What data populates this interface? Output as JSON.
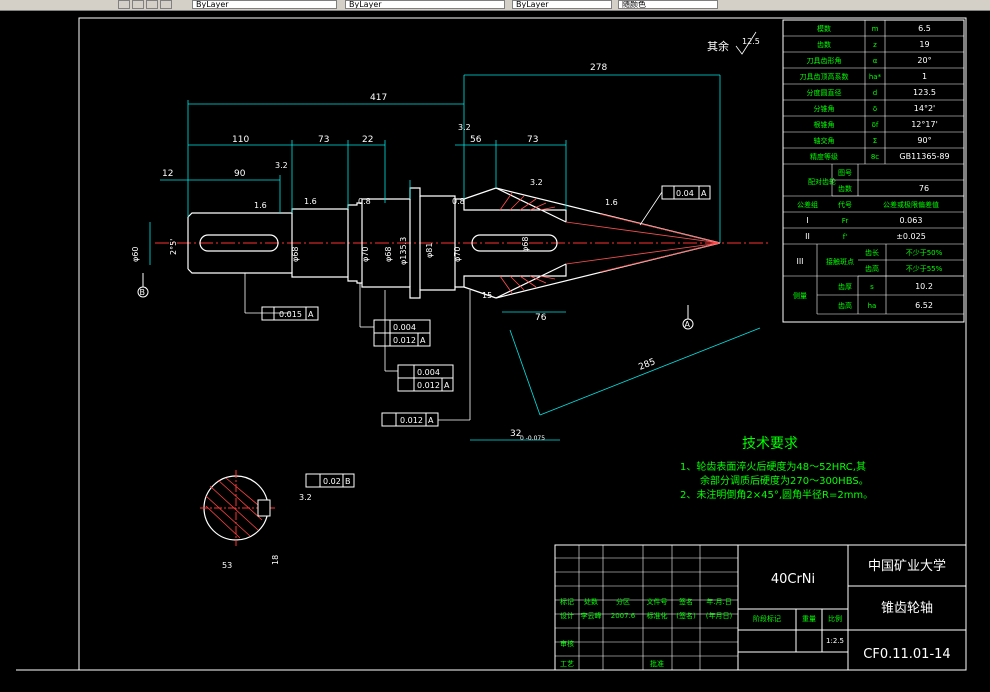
{
  "toolbar": {
    "layer_combo": "ByLayer",
    "linetype_combo": "ByLayer",
    "lineweight_combo": "ByLayer",
    "color_combo": "随颜色"
  },
  "drawing": {
    "surface_roughness_note": "其余",
    "surface_roughness_value": "12.5",
    "dimensions": {
      "overall_length": "417",
      "gear_length": "278",
      "d110": "110",
      "d73a": "73",
      "d22": "22",
      "d56": "56",
      "d73b": "73",
      "d12": "12",
      "d90": "90",
      "d76": "76",
      "d285": "285",
      "d32": "32",
      "d32_tol": "0 -0.075",
      "r16a": "1.6",
      "r16b": "1.6",
      "r08a": "0.8",
      "r08b": "0.8",
      "r32a": "3.2",
      "r32b": "3.2",
      "r32c": "3.2",
      "r16c": "1.6",
      "dia60": "φ60",
      "dia68": "φ68",
      "dia70a": "φ70",
      "dia70b": "φ70",
      "dia135": "φ135.3",
      "dia81": "φ81",
      "dia68b": "φ68",
      "angle": "2°5'",
      "r15": "15",
      "section_w": "53",
      "section_d": "18",
      "section_r": "3.2",
      "datum_a": "A",
      "datum_b": "B"
    },
    "tolerances": {
      "t1": "0.04",
      "t2": "0.015",
      "t3": "0.004",
      "t4": "0.012",
      "t5": "0.004",
      "t6": "0.012",
      "t7": "0.012",
      "t8": "0.02",
      "ref_a": "A",
      "ref_b": "B"
    }
  },
  "params_table": {
    "rows": [
      [
        "模数",
        "m",
        "6.5"
      ],
      [
        "齿数",
        "z",
        "19"
      ],
      [
        "刀具齿形角",
        "α",
        "20°"
      ],
      [
        "刀具齿顶高系数",
        "ha*",
        "1"
      ],
      [
        "分度圆直径",
        "d",
        "123.5"
      ],
      [
        "分锥角",
        "δ",
        "14°2'"
      ],
      [
        "根锥角",
        "δf",
        "12°17'"
      ],
      [
        "轴交角",
        "Σ",
        "90°"
      ],
      [
        "精度等级",
        "8c",
        "GB11365-89"
      ]
    ],
    "mate_label": "配对齿轮",
    "mate_rows": [
      [
        "图号",
        ""
      ],
      [
        "齿数",
        "76"
      ]
    ],
    "group_header": [
      "公差组",
      "代号",
      "公差或极限偏差值"
    ],
    "group_rows": [
      [
        "I",
        "Fr",
        "0.063"
      ],
      [
        "II",
        "f'",
        "±0.025"
      ]
    ],
    "group3_label": "III",
    "contact_label": "接触斑点",
    "contact_rows": [
      [
        "齿长",
        "不少于50%"
      ],
      [
        "齿高",
        "不少于55%"
      ]
    ],
    "measure_label": "侧量",
    "measure_rows": [
      [
        "齿厚",
        "s",
        "10.2"
      ],
      [
        "齿高",
        "ha",
        "6.52"
      ]
    ]
  },
  "tech": {
    "title": "技术要求",
    "lines": [
      "1、轮齿表面淬火后硬度为48～52HRC,其",
      "余部分调质后硬度为270～300HBS。",
      "2、未注明倒角2×45°,圆角半径R=2mm。"
    ]
  },
  "title_block": {
    "material": "40CrNi",
    "school": "中国矿业大学",
    "part_name": "锥齿轮轴",
    "drawing_no": "CF0.11.01-14",
    "scale": "1:2.5",
    "labels": {
      "mark": "标记",
      "count": "处数",
      "zone": "分区",
      "doc": "文件号",
      "sign": "签名",
      "date": "年.月.日",
      "design": "设计",
      "designer": "李云峰",
      "design_date": "2007.6",
      "std": "标准化",
      "sign2": "(签名)",
      "date2": "(年月日)",
      "stage": "阶段标记",
      "weight": "重量",
      "scale_lbl": "比例",
      "review": "审核",
      "process": "工艺",
      "approve": "批准"
    }
  }
}
